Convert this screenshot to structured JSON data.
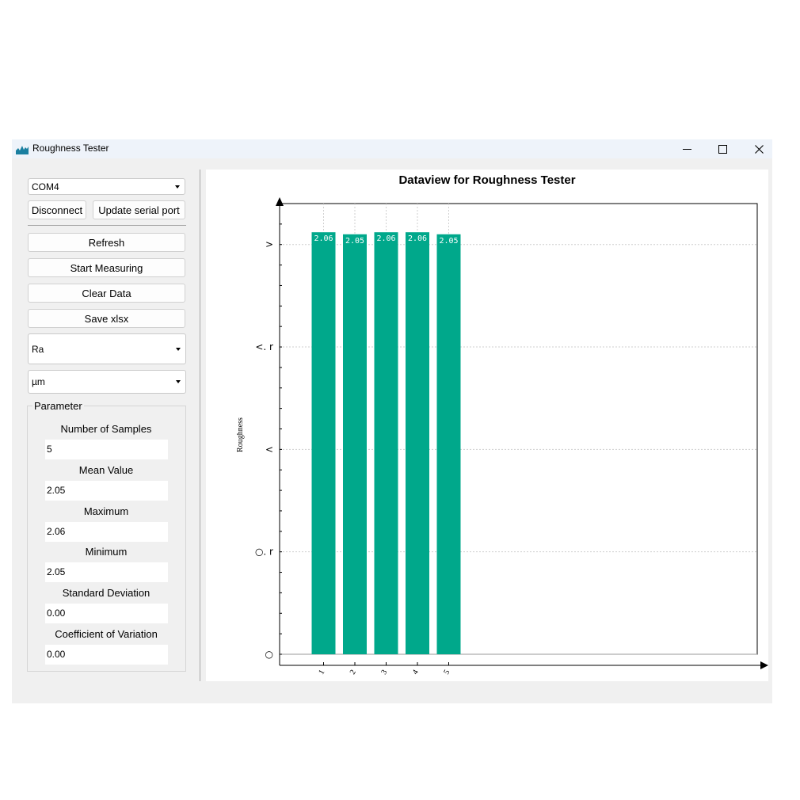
{
  "window": {
    "title": "Roughness Tester"
  },
  "serial": {
    "port_value": "COM4",
    "disconnect_label": "Disconnect",
    "update_label": "Update serial port"
  },
  "actions": {
    "refresh": "Refresh",
    "start": "Start Measuring",
    "clear": "Clear Data",
    "save": "Save xlsx"
  },
  "selectors": {
    "parameter_value": "Ra",
    "unit_value": "µm"
  },
  "parameter": {
    "group_title": "Parameter",
    "fields": [
      {
        "label": "Number of Samples",
        "value": "5"
      },
      {
        "label": "Mean Value",
        "value": "2.05"
      },
      {
        "label": "Maximum",
        "value": "2.06"
      },
      {
        "label": "Minimum",
        "value": "2.05"
      },
      {
        "label": "Standard Deviation",
        "value": "0.00"
      },
      {
        "label": "Coefficient of Variation",
        "value": "0.00"
      }
    ]
  },
  "colors": {
    "bar": "#00a88b",
    "accent": "#1a7fa0"
  },
  "chart_data": {
    "type": "bar",
    "title": "Dataview for Roughness Tester",
    "ylabel": "Roughness",
    "xlabel": "",
    "categories": [
      "1",
      "2",
      "3",
      "4",
      "5"
    ],
    "values": [
      2.06,
      2.05,
      2.06,
      2.06,
      2.05
    ],
    "value_labels": [
      "2.06",
      "2.05",
      "2.06",
      "2.06",
      "2.05"
    ],
    "ylim": [
      0,
      2.2
    ],
    "yticks": [
      0,
      0.5,
      1.0,
      1.5,
      2.0
    ],
    "ytick_labels": [
      "○",
      "○. r",
      "<",
      "<. r",
      ">"
    ],
    "grid": true
  }
}
